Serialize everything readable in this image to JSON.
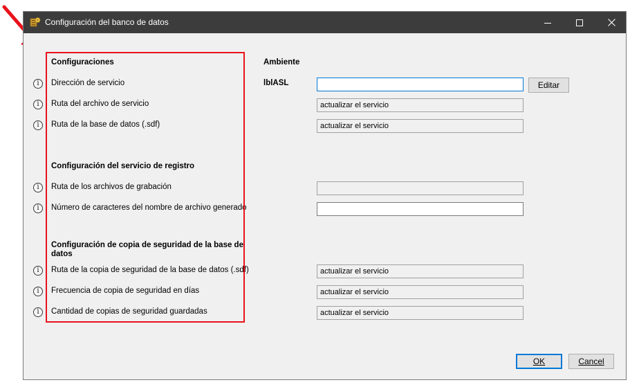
{
  "window": {
    "title": "Configuración del banco de datos",
    "icon": "database-settings-icon"
  },
  "sections": {
    "configuraciones": "Configuraciones",
    "registro": "Configuración del servicio de registro",
    "copia": "Configuración de copia de seguridad de la base de datos"
  },
  "ambiente": {
    "header": "Ambiente",
    "name": "lblASL"
  },
  "rows": {
    "direccion": {
      "label": "Dirección de servicio",
      "value": ""
    },
    "ruta_archivo": {
      "label": "Ruta del archivo de servicio",
      "value": "actualizar el servicio"
    },
    "ruta_bd": {
      "label": "Ruta de la base de datos (.sdf)",
      "value": "actualizar el servicio"
    },
    "ruta_grabacion": {
      "label": "Ruta de los archivos de grabación",
      "value": ""
    },
    "num_caracteres": {
      "label": "Número de caracteres del nombre de archivo generado",
      "value": ""
    },
    "ruta_copia": {
      "label": "Ruta de la copia de seguridad de la base de datos (.sdf)",
      "value": "actualizar el servicio"
    },
    "frecuencia": {
      "label": "Frecuencia de copia de seguridad en días",
      "value": "actualizar el servicio"
    },
    "cantidad": {
      "label": "Cantidad de copias de seguridad guardadas",
      "value": "actualizar el servicio"
    }
  },
  "buttons": {
    "editar": "Editar",
    "ok": "OK",
    "cancel": "Cancel"
  },
  "info_glyph": "i",
  "colors": {
    "titlebar": "#3c3c3c",
    "highlight": "#e8121b",
    "focus": "#0078d7"
  }
}
